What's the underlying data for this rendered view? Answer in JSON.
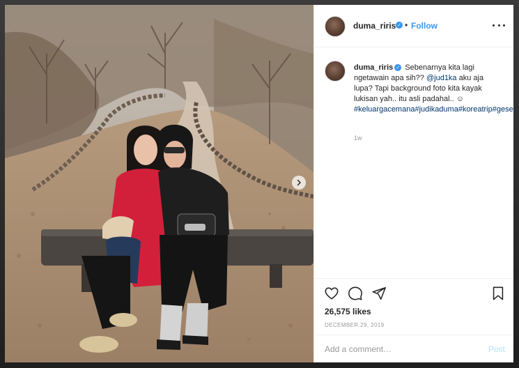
{
  "post": {
    "username": "duma_riris",
    "follow_label": "Follow",
    "separator": "•",
    "verified_glyph": "✓",
    "caption": {
      "username": "duma_riris",
      "text_1": "Sebenarnya kita lagi ngetawain apa sih?? ",
      "mention": "@jud1ka",
      "text_2": " aku aja lupa? Tapi background foto kita kayak lukisan yah.. itu asli padahal.. ☺",
      "tags": "#keluargacemana#judikaduma#koreatrip#geserkekiri",
      "time": "1w"
    },
    "likes": "26,575 likes",
    "date": "DECEMBER 29, 2019",
    "comment_placeholder": "Add a comment…",
    "post_label": "Post"
  },
  "icons": {
    "heart": "heart-icon",
    "comment": "comment-icon",
    "share": "share-icon",
    "bookmark": "bookmark-icon",
    "more": "more-options-icon",
    "next": "chevron-right-icon"
  },
  "colors": {
    "link": "#3897f0",
    "hashtag": "#003569",
    "muted": "#999999",
    "text": "#262626"
  }
}
